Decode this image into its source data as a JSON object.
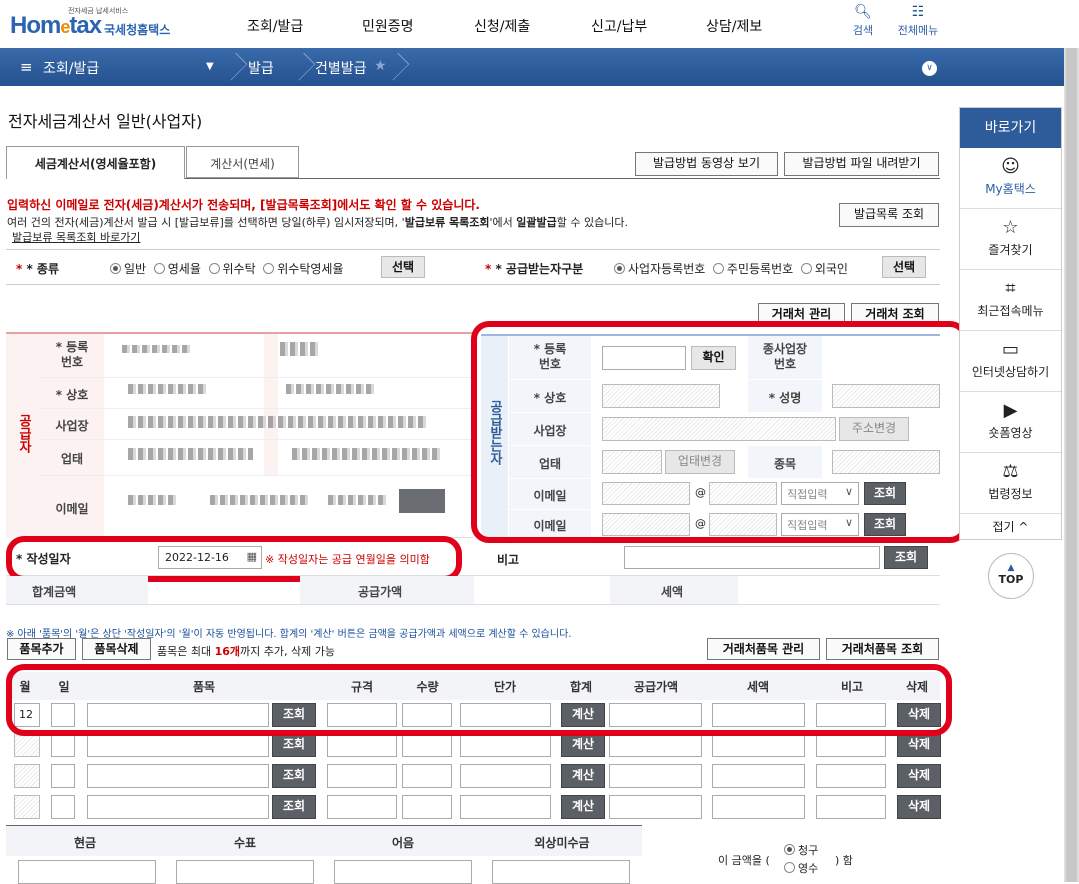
{
  "logo": {
    "small": "전자세금 납세서비스",
    "brand_a": "Hom",
    "brand_b": "e",
    "brand_c": "tax",
    "kr": "국세청홈택스"
  },
  "top_menu": [
    "조회/발급",
    "민원증명",
    "신청/제출",
    "신고/납부",
    "상담/제보"
  ],
  "top_icons": {
    "search": "검색",
    "all_menu": "전체메뉴"
  },
  "nav": {
    "menu_label": "조회/발급",
    "crumb1": "발급",
    "crumb2": "건별발급"
  },
  "page_title": "전자세금계산서 일반(사업자)",
  "tabs": [
    "세금계산서(영세율포함)",
    "계산서(면세)"
  ],
  "buttons": {
    "video": "발급방법 동영상 보기",
    "download": "발급방법 파일 내려받기",
    "issue_list": "발급목록 조회",
    "select": "선택",
    "partner_manage": "거래처 관리",
    "partner_search": "거래처 조회",
    "confirm": "확인",
    "address_change": "주소변경",
    "industry_change": "업태변경",
    "search": "조회",
    "item_add": "품목추가",
    "item_delete": "품목삭제",
    "partner_item_manage": "거래처품목 관리",
    "partner_item_search": "거래처품목 조회",
    "calc": "계산",
    "del": "삭제"
  },
  "notice": {
    "line1": "입력하신 이메일로 전자(세금)계산서가 전송되며, [발급목록조회]에서도 확인 할 수 있습니다.",
    "line2a": "여러 건의 전자(세금)계산서 발급 시 [발급보류]를 선택하면 당일(하루) 임시저장되며, '",
    "line2b": "발급보류 목록조회",
    "line2c": "'에서 ",
    "line2d": "일괄발급",
    "line2e": "할 수 있습니다.",
    "link": "발급보류 목록조회 바로가기"
  },
  "kind": {
    "label": "* 종류",
    "options": [
      "일반",
      "영세율",
      "위수탁",
      "위수탁영세율"
    ],
    "selected": 0
  },
  "receiver_type": {
    "label": "* 공급받는자구분",
    "options": [
      "사업자등록번호",
      "주민등록번호",
      "외국인"
    ],
    "selected": 0
  },
  "supplier": {
    "side_label": "공급자",
    "fields": [
      "* 등록\n번호",
      "* 상호",
      "사업장",
      "업태",
      "이메일"
    ]
  },
  "receiver": {
    "side_label": "공급받는자",
    "reg_no": "* 등록\n번호",
    "sub_biz": "종사업장\n번호",
    "name": "* 상호",
    "ceo": "* 성명",
    "address": "사업장",
    "industry": "업태",
    "item": "종목",
    "email": "이메일",
    "at": "@",
    "direct_input": "직접입력"
  },
  "date": {
    "label": "* 작성일자",
    "value": "2022-12-16",
    "hint": "※ 작성일자는 공급 연월일을 의미함",
    "remark": "비고"
  },
  "totals": {
    "total": "합계금액",
    "supply": "공급가액",
    "tax": "세액"
  },
  "items_notice": "※ 아래 '품목'의 '월'은 상단 '작성일자'의 '월'이 자동 반영됩니다. 합계의 '계산' 버튼은 금액을 공급가액과 세액으로 계산할 수 있습니다.",
  "items_limit_a": "품목은 최대 ",
  "items_limit_b": "16개",
  "items_limit_c": "까지 추가, 삭제 가능",
  "item_headers": [
    "월",
    "일",
    "품목",
    "규격",
    "수량",
    "단가",
    "합계",
    "공급가액",
    "세액",
    "비고",
    "삭제"
  ],
  "first_month": "12",
  "payment_headers": [
    "현금",
    "수표",
    "어음",
    "외상미수금"
  ],
  "amount_as": {
    "prefix": "이 금액을 (",
    "opt1": "청구",
    "opt2": "영수",
    "suffix": ") 함"
  },
  "sidebar": {
    "head": "바로가기",
    "items": [
      "My홈택스",
      "즐겨찾기",
      "최근접속메뉴",
      "인터넷상담하기",
      "숏폼영상",
      "법령정보"
    ],
    "fold": "접기 ^"
  },
  "top_btn": "TOP"
}
